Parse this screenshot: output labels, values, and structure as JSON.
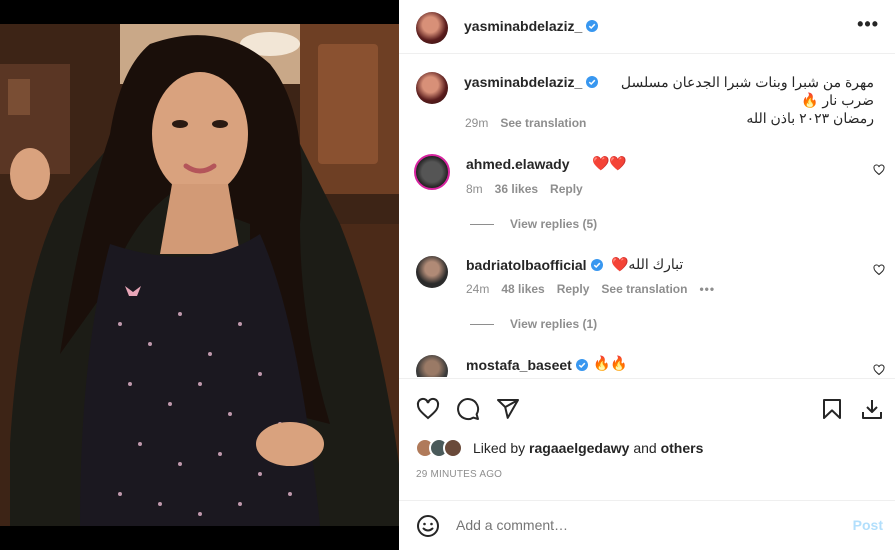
{
  "post": {
    "author": "yasminabdelaziz_",
    "caption_emoji": "🔥",
    "caption_line1": "مهرة من شبرا وبنات شبرا الجدعان مسلسل ضرب نار",
    "caption_line2": "رمضان ٢٠٢٣ باذن الله",
    "caption_time": "29m",
    "see_translation": "See translation"
  },
  "comments": [
    {
      "user": "ahmed.elawady",
      "verified": false,
      "text": "❤️❤️",
      "time": "8m",
      "likes": "36 likes",
      "reply": "Reply",
      "view_replies": "View replies (5)"
    },
    {
      "user": "badriatolbaofficial",
      "verified": true,
      "text": "تبارك الله❤️",
      "time": "24m",
      "likes": "48 likes",
      "reply": "Reply",
      "see_translation": "See translation",
      "more": "•••",
      "view_replies": "View replies (1)"
    },
    {
      "user": "mostafa_baseet",
      "verified": true,
      "text": "🔥🔥"
    }
  ],
  "liked": {
    "prefix": "Liked by ",
    "user": "ragaaelgedawy",
    "mid": " and ",
    "others": "others"
  },
  "time_ago": "29 MINUTES AGO",
  "add_comment": {
    "placeholder": "Add a comment…",
    "post_label": "Post"
  },
  "header": {
    "more": "•••"
  },
  "colors": {
    "verified": "#3897f0",
    "link": "#0095f6",
    "post_disabled": "#b2dffc",
    "muted": "#8e8e8e",
    "heart": "#ed4956"
  },
  "icons": [
    "more-icon",
    "heart-icon",
    "comment-icon",
    "share-icon",
    "save-icon",
    "download-icon",
    "emoji-icon",
    "verified-icon"
  ]
}
